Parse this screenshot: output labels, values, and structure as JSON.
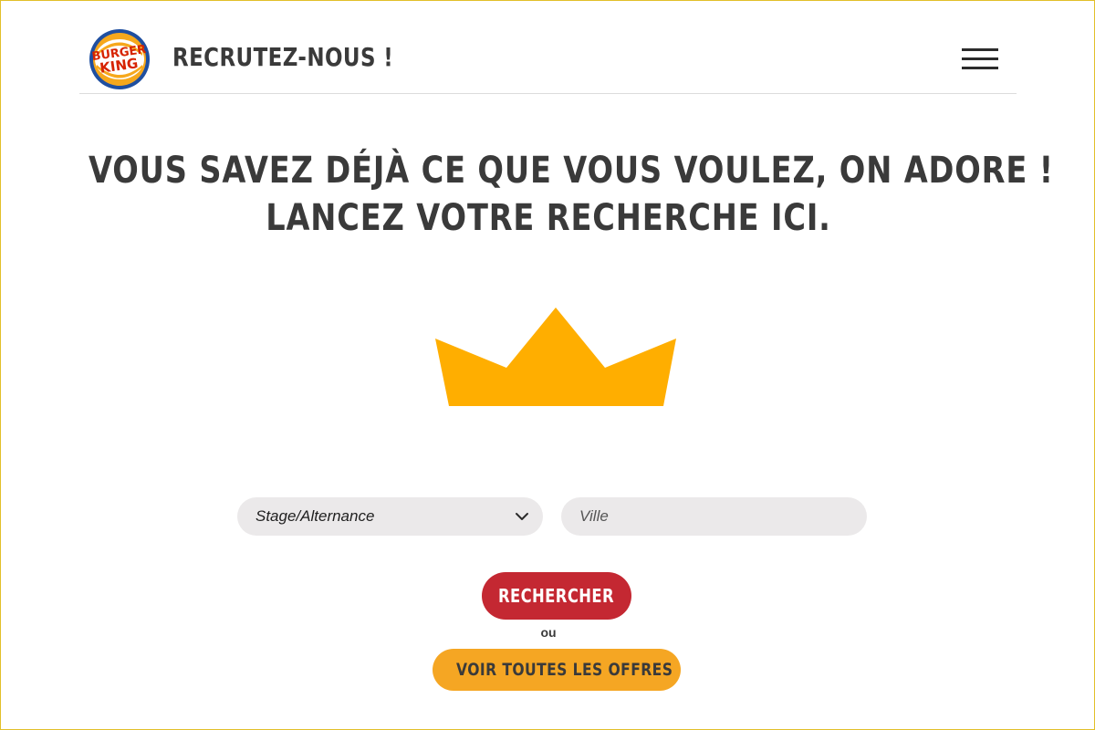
{
  "header": {
    "logo_text_top": "BURGER",
    "logo_text_bottom": "KING",
    "title": "RECRUTEZ-NOUS !",
    "menu_icon": "hamburger-menu-icon"
  },
  "headline": {
    "line1": "VOUS SAVEZ DÉJÀ CE QUE VOUS VOULEZ, ON ADORE !",
    "line2": "LANCEZ VOTRE RECHERCHE ICI."
  },
  "decoration": {
    "crown_icon": "crown-icon",
    "crown_color": "#ffae00"
  },
  "search_form": {
    "contract_type_selected": "Stage/Alternance",
    "city_placeholder": "Ville",
    "city_value": "",
    "search_label": "RECHERCHER",
    "or_label": "ou",
    "all_offers_label": "VOIR TOUTES LES OFFRES"
  },
  "colors": {
    "primary_red": "#c42832",
    "secondary_orange": "#f5a623",
    "text_dark": "#3a3a3a",
    "field_background": "#ebe9ea",
    "frame_border": "#e2bf2a"
  }
}
